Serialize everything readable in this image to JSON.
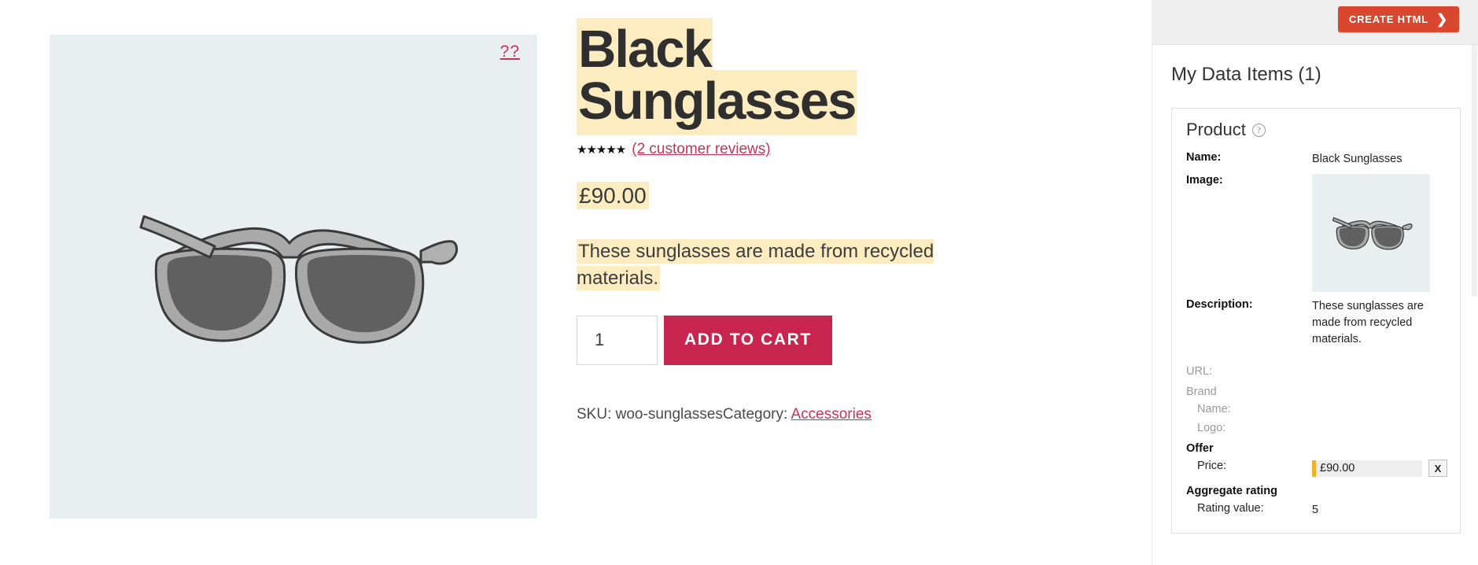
{
  "shop": {
    "gallery": {
      "zoom_label": "??",
      "image_alt": "black-sunglasses-illustration"
    },
    "product": {
      "title_line1": "Black",
      "title_line2": "Sunglasses",
      "stars": "★★★★★",
      "reviews_link": "(2 customer reviews)",
      "price": "£90.00",
      "short_description": "These sunglasses are made from recycled materials.",
      "quantity": "1",
      "add_to_cart_label": "ADD TO CART",
      "sku_label": "SKU:",
      "sku_value": "woo-sunglasses",
      "category_label": "Category:",
      "category_value": "Accessories"
    }
  },
  "extension": {
    "toolbar": {
      "create_html_label": "CREATE HTML",
      "chevron": "❯"
    },
    "heading": "My Data Items (1)",
    "card": {
      "title": "Product",
      "help_glyph": "?",
      "fields": {
        "name_label": "Name:",
        "name_value": "Black Sunglasses",
        "image_label": "Image:",
        "description_label": "Description:",
        "description_value": "These sunglasses are made from recycled materials.",
        "url_label": "URL:",
        "url_value": "",
        "brand_group": "Brand",
        "brand_name_label": "Name:",
        "brand_name_value": "",
        "brand_logo_label": "Logo:",
        "brand_logo_value": "",
        "offer_group": "Offer",
        "price_label": "Price:",
        "price_value": "£90.00",
        "price_clear_label": "X",
        "aggregate_group": "Aggregate rating",
        "rating_value_label": "Rating value:",
        "rating_value": "5"
      }
    }
  },
  "colors": {
    "accent_crimson": "#c9264f",
    "link_crimson": "#c7345a",
    "highlight_yellow": "#fdecc0",
    "create_html_red": "#d9472f",
    "marker_amber": "#f0b323",
    "gallery_bg": "#e9eef1"
  }
}
